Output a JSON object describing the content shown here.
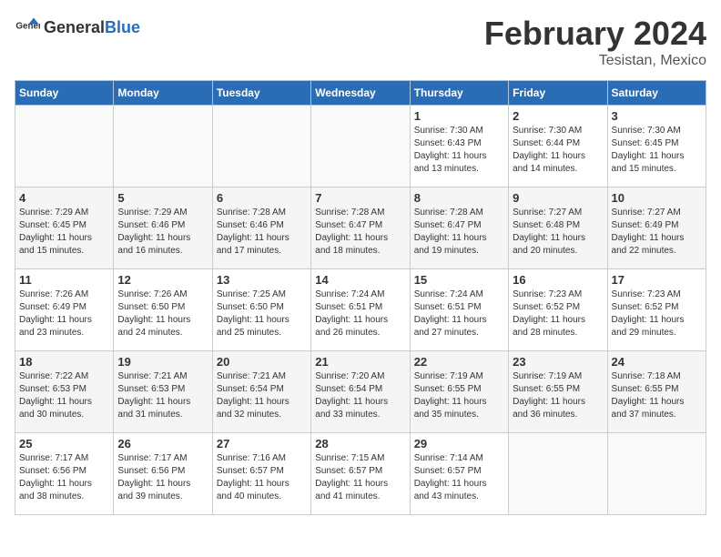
{
  "header": {
    "logo_general": "General",
    "logo_blue": "Blue",
    "title": "February 2024",
    "subtitle": "Tesistan, Mexico"
  },
  "days_of_week": [
    "Sunday",
    "Monday",
    "Tuesday",
    "Wednesday",
    "Thursday",
    "Friday",
    "Saturday"
  ],
  "weeks": [
    [
      {
        "day": "",
        "detail": ""
      },
      {
        "day": "",
        "detail": ""
      },
      {
        "day": "",
        "detail": ""
      },
      {
        "day": "",
        "detail": ""
      },
      {
        "day": "1",
        "detail": "Sunrise: 7:30 AM\nSunset: 6:43 PM\nDaylight: 11 hours\nand 13 minutes."
      },
      {
        "day": "2",
        "detail": "Sunrise: 7:30 AM\nSunset: 6:44 PM\nDaylight: 11 hours\nand 14 minutes."
      },
      {
        "day": "3",
        "detail": "Sunrise: 7:30 AM\nSunset: 6:45 PM\nDaylight: 11 hours\nand 15 minutes."
      }
    ],
    [
      {
        "day": "4",
        "detail": "Sunrise: 7:29 AM\nSunset: 6:45 PM\nDaylight: 11 hours\nand 15 minutes."
      },
      {
        "day": "5",
        "detail": "Sunrise: 7:29 AM\nSunset: 6:46 PM\nDaylight: 11 hours\nand 16 minutes."
      },
      {
        "day": "6",
        "detail": "Sunrise: 7:28 AM\nSunset: 6:46 PM\nDaylight: 11 hours\nand 17 minutes."
      },
      {
        "day": "7",
        "detail": "Sunrise: 7:28 AM\nSunset: 6:47 PM\nDaylight: 11 hours\nand 18 minutes."
      },
      {
        "day": "8",
        "detail": "Sunrise: 7:28 AM\nSunset: 6:47 PM\nDaylight: 11 hours\nand 19 minutes."
      },
      {
        "day": "9",
        "detail": "Sunrise: 7:27 AM\nSunset: 6:48 PM\nDaylight: 11 hours\nand 20 minutes."
      },
      {
        "day": "10",
        "detail": "Sunrise: 7:27 AM\nSunset: 6:49 PM\nDaylight: 11 hours\nand 22 minutes."
      }
    ],
    [
      {
        "day": "11",
        "detail": "Sunrise: 7:26 AM\nSunset: 6:49 PM\nDaylight: 11 hours\nand 23 minutes."
      },
      {
        "day": "12",
        "detail": "Sunrise: 7:26 AM\nSunset: 6:50 PM\nDaylight: 11 hours\nand 24 minutes."
      },
      {
        "day": "13",
        "detail": "Sunrise: 7:25 AM\nSunset: 6:50 PM\nDaylight: 11 hours\nand 25 minutes."
      },
      {
        "day": "14",
        "detail": "Sunrise: 7:24 AM\nSunset: 6:51 PM\nDaylight: 11 hours\nand 26 minutes."
      },
      {
        "day": "15",
        "detail": "Sunrise: 7:24 AM\nSunset: 6:51 PM\nDaylight: 11 hours\nand 27 minutes."
      },
      {
        "day": "16",
        "detail": "Sunrise: 7:23 AM\nSunset: 6:52 PM\nDaylight: 11 hours\nand 28 minutes."
      },
      {
        "day": "17",
        "detail": "Sunrise: 7:23 AM\nSunset: 6:52 PM\nDaylight: 11 hours\nand 29 minutes."
      }
    ],
    [
      {
        "day": "18",
        "detail": "Sunrise: 7:22 AM\nSunset: 6:53 PM\nDaylight: 11 hours\nand 30 minutes."
      },
      {
        "day": "19",
        "detail": "Sunrise: 7:21 AM\nSunset: 6:53 PM\nDaylight: 11 hours\nand 31 minutes."
      },
      {
        "day": "20",
        "detail": "Sunrise: 7:21 AM\nSunset: 6:54 PM\nDaylight: 11 hours\nand 32 minutes."
      },
      {
        "day": "21",
        "detail": "Sunrise: 7:20 AM\nSunset: 6:54 PM\nDaylight: 11 hours\nand 33 minutes."
      },
      {
        "day": "22",
        "detail": "Sunrise: 7:19 AM\nSunset: 6:55 PM\nDaylight: 11 hours\nand 35 minutes."
      },
      {
        "day": "23",
        "detail": "Sunrise: 7:19 AM\nSunset: 6:55 PM\nDaylight: 11 hours\nand 36 minutes."
      },
      {
        "day": "24",
        "detail": "Sunrise: 7:18 AM\nSunset: 6:55 PM\nDaylight: 11 hours\nand 37 minutes."
      }
    ],
    [
      {
        "day": "25",
        "detail": "Sunrise: 7:17 AM\nSunset: 6:56 PM\nDaylight: 11 hours\nand 38 minutes."
      },
      {
        "day": "26",
        "detail": "Sunrise: 7:17 AM\nSunset: 6:56 PM\nDaylight: 11 hours\nand 39 minutes."
      },
      {
        "day": "27",
        "detail": "Sunrise: 7:16 AM\nSunset: 6:57 PM\nDaylight: 11 hours\nand 40 minutes."
      },
      {
        "day": "28",
        "detail": "Sunrise: 7:15 AM\nSunset: 6:57 PM\nDaylight: 11 hours\nand 41 minutes."
      },
      {
        "day": "29",
        "detail": "Sunrise: 7:14 AM\nSunset: 6:57 PM\nDaylight: 11 hours\nand 43 minutes."
      },
      {
        "day": "",
        "detail": ""
      },
      {
        "day": "",
        "detail": ""
      }
    ]
  ]
}
